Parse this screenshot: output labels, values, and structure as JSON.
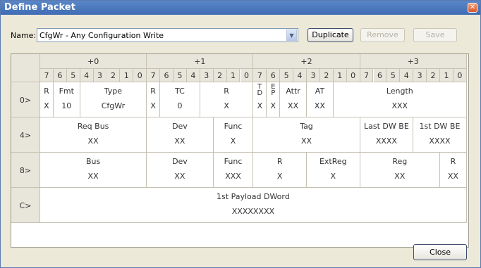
{
  "window": {
    "title": "Define Packet"
  },
  "name_field": {
    "label": "Name:",
    "value": "CfgWr - Any Configuration Write"
  },
  "buttons": {
    "duplicate": "Duplicate",
    "remove": "Remove",
    "save": "Save",
    "close": "Close"
  },
  "byte_headers": [
    "+0",
    "+1",
    "+2",
    "+3"
  ],
  "bit_headers": [
    "7",
    "6",
    "5",
    "4",
    "3",
    "2",
    "1",
    "0"
  ],
  "rows": [
    {
      "label": "0>",
      "fields": [
        {
          "name": "R",
          "value": "X",
          "start": 0,
          "span": 1
        },
        {
          "name": "Fmt",
          "value": "10",
          "start": 1,
          "span": 2
        },
        {
          "name": "Type",
          "value": "CfgWr",
          "start": 3,
          "span": 5
        },
        {
          "name": "R",
          "value": "X",
          "start": 8,
          "span": 1
        },
        {
          "name": "TC",
          "value": "0",
          "start": 9,
          "span": 3
        },
        {
          "name": "R",
          "value": "X",
          "start": 12,
          "span": 4
        },
        {
          "name": "TD",
          "value": "X",
          "start": 16,
          "span": 1,
          "vertical": true
        },
        {
          "name": "EP",
          "value": "X",
          "start": 17,
          "span": 1,
          "vertical": true
        },
        {
          "name": "Attr",
          "value": "XX",
          "start": 18,
          "span": 2
        },
        {
          "name": "AT",
          "value": "XX",
          "start": 20,
          "span": 2
        },
        {
          "name": "Length",
          "value": "XXX",
          "start": 22,
          "span": 10
        }
      ]
    },
    {
      "label": "4>",
      "fields": [
        {
          "name": "Req Bus",
          "value": "XX",
          "start": 0,
          "span": 8
        },
        {
          "name": "Dev",
          "value": "XX",
          "start": 8,
          "span": 5
        },
        {
          "name": "Func",
          "value": "X",
          "start": 13,
          "span": 3
        },
        {
          "name": "Tag",
          "value": "XX",
          "start": 16,
          "span": 8
        },
        {
          "name": "Last DW BE",
          "value": "XXXX",
          "start": 24,
          "span": 4
        },
        {
          "name": "1st DW BE",
          "value": "XXXX",
          "start": 28,
          "span": 4
        }
      ]
    },
    {
      "label": "8>",
      "fields": [
        {
          "name": "Bus",
          "value": "XX",
          "start": 0,
          "span": 8
        },
        {
          "name": "Dev",
          "value": "XX",
          "start": 8,
          "span": 5
        },
        {
          "name": "Func",
          "value": "XXX",
          "start": 13,
          "span": 3
        },
        {
          "name": "R",
          "value": "X",
          "start": 16,
          "span": 4
        },
        {
          "name": "ExtReg",
          "value": "X",
          "start": 20,
          "span": 4
        },
        {
          "name": "Reg",
          "value": "XX",
          "start": 24,
          "span": 6
        },
        {
          "name": "R",
          "value": "XX",
          "start": 30,
          "span": 2
        }
      ]
    },
    {
      "label": "C>",
      "fields": [
        {
          "name": "1st Payload DWord",
          "value": "XXXXXXXX",
          "start": 0,
          "span": 32
        }
      ]
    }
  ]
}
